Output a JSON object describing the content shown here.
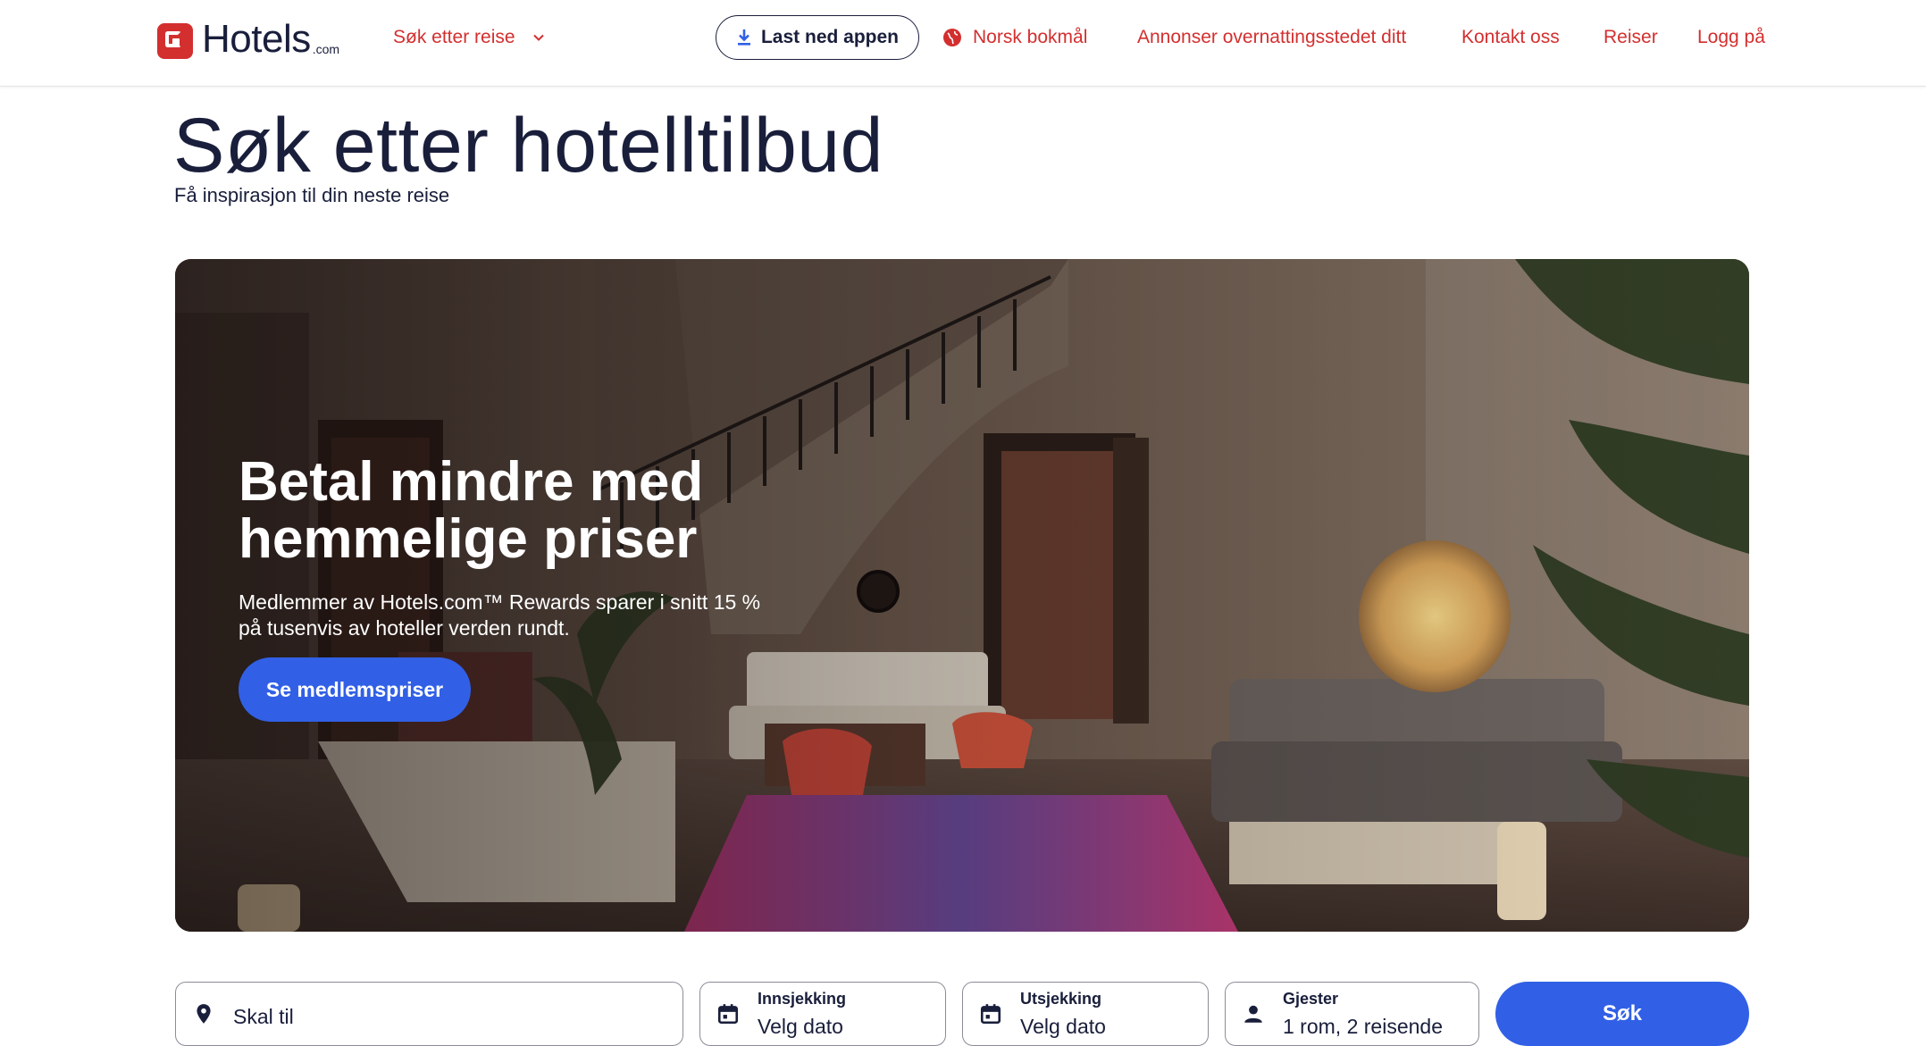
{
  "header": {
    "logo_text": "Hotels",
    "logo_suffix": ".com",
    "trip_menu_label": "Søk etter reise",
    "app_button_label": "Last ned appen",
    "language_label": "Norsk bokmål",
    "list_property_label": "Annonser overnattingsstedet ditt",
    "contact_label": "Kontakt oss",
    "trips_label": "Reiser",
    "login_label": "Logg på"
  },
  "page": {
    "title": "Søk etter hotelltilbud",
    "subtitle": "Få inspirasjon til din neste reise"
  },
  "hero": {
    "title": "Betal mindre med hemmelige priser",
    "text": "Medlemmer av Hotels.com™ Rewards sparer i snitt 15 % på tusenvis av hoteller verden rundt.",
    "button_label": "Se medlemspriser"
  },
  "search": {
    "destination_placeholder": "Skal til",
    "checkin_label": "Innsjekking",
    "checkin_value": "Velg dato",
    "checkout_label": "Utsjekking",
    "checkout_value": "Velg dato",
    "guests_label": "Gjester",
    "guests_value": "1 rom, 2 reisende",
    "submit_label": "Søk"
  },
  "colors": {
    "brand_red": "#d32f2f",
    "primary_blue": "#3160e6",
    "text_dark": "#191e3b"
  },
  "icons": [
    "download-icon",
    "globe-icon",
    "chevron-down-icon",
    "location-pin-icon",
    "calendar-icon",
    "person-icon"
  ]
}
